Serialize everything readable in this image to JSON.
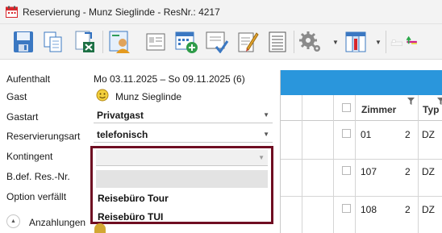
{
  "window": {
    "title": "Reservierung - Munz Sieglinde - ResNr.: 4217"
  },
  "toolbar": {
    "buttons": [
      {
        "icon": "save-icon"
      },
      {
        "icon": "copy-icon"
      },
      {
        "icon": "excel-export-icon"
      },
      {
        "icon": "guest-card-icon"
      },
      {
        "icon": "registration-form-icon"
      },
      {
        "icon": "calendar-add-icon"
      },
      {
        "icon": "confirm-document-icon"
      },
      {
        "icon": "edit-document-icon"
      },
      {
        "icon": "list-document-icon"
      },
      {
        "icon": "settings-gear-icon"
      },
      {
        "icon": "column-layout-icon"
      },
      {
        "icon": "room-bed-icon"
      }
    ]
  },
  "form": {
    "aufenthalt_label": "Aufenthalt",
    "aufenthalt_value": "Mo 03.11.2025 – So 09.11.2025 (6)",
    "gast_label": "Gast",
    "gast_value": "Munz Sieglinde",
    "gastart_label": "Gastart",
    "gastart_value": "Privatgast",
    "reservierungsart_label": "Reservierungsart",
    "reservierungsart_value": "telefonisch",
    "kontingent_label": "Kontingent",
    "bdef_label": "B.def. Res.-Nr.",
    "option_label": "Option verfällt",
    "anzahlungen_label": "Anzahlungen"
  },
  "kontingent_dropdown": {
    "selected": "",
    "options": [
      "",
      "Reisebüro Tour",
      "Reisebüro TUI"
    ]
  },
  "grid": {
    "header_color": "#2a96dc",
    "columns": [
      "Zimmer",
      "Typ"
    ],
    "rows": [
      {
        "zimmer": "01",
        "count": "2",
        "typ": "DZ"
      },
      {
        "zimmer": "107",
        "count": "2",
        "typ": "DZ"
      },
      {
        "zimmer": "108",
        "count": "2",
        "typ": "DZ"
      }
    ]
  },
  "colors": {
    "dropdown_highlight_border": "#6f0e22",
    "accent": "#2a96dc"
  }
}
